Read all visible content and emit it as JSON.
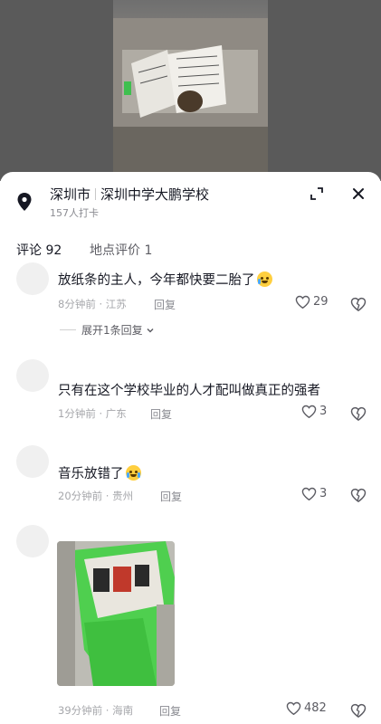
{
  "location": {
    "city": "深圳市",
    "place": "深圳中学大鹏学校",
    "checkins": "157人打卡"
  },
  "tabs": [
    {
      "label": "评论 92"
    },
    {
      "label": "地点评价 1"
    }
  ],
  "comments": [
    {
      "text": "放纸条的主人，今年都快要二胎了",
      "time": "8分钟前 · 江苏",
      "reply": "回复",
      "likes": "29",
      "expand": "展开1条回复"
    },
    {
      "text": "只有在这个学校毕业的人才配叫做真正的强者",
      "time": "1分钟前 · 广东",
      "reply": "回复",
      "likes": "3"
    },
    {
      "text": "音乐放错了",
      "time": "20分钟前 · 贵州",
      "reply": "回复",
      "likes": "3"
    },
    {
      "text": "",
      "time": "39分钟前 · 海南",
      "reply": "回复",
      "likes": "482"
    }
  ],
  "colors": {
    "accent": "#161823",
    "meta": "#a6a7ab",
    "emoji": "#ffcf3f"
  },
  "icons": [
    "location-pin-icon",
    "expand-icon",
    "close-icon",
    "heart-icon",
    "dislike-heart-icon",
    "chevron-down-icon"
  ]
}
